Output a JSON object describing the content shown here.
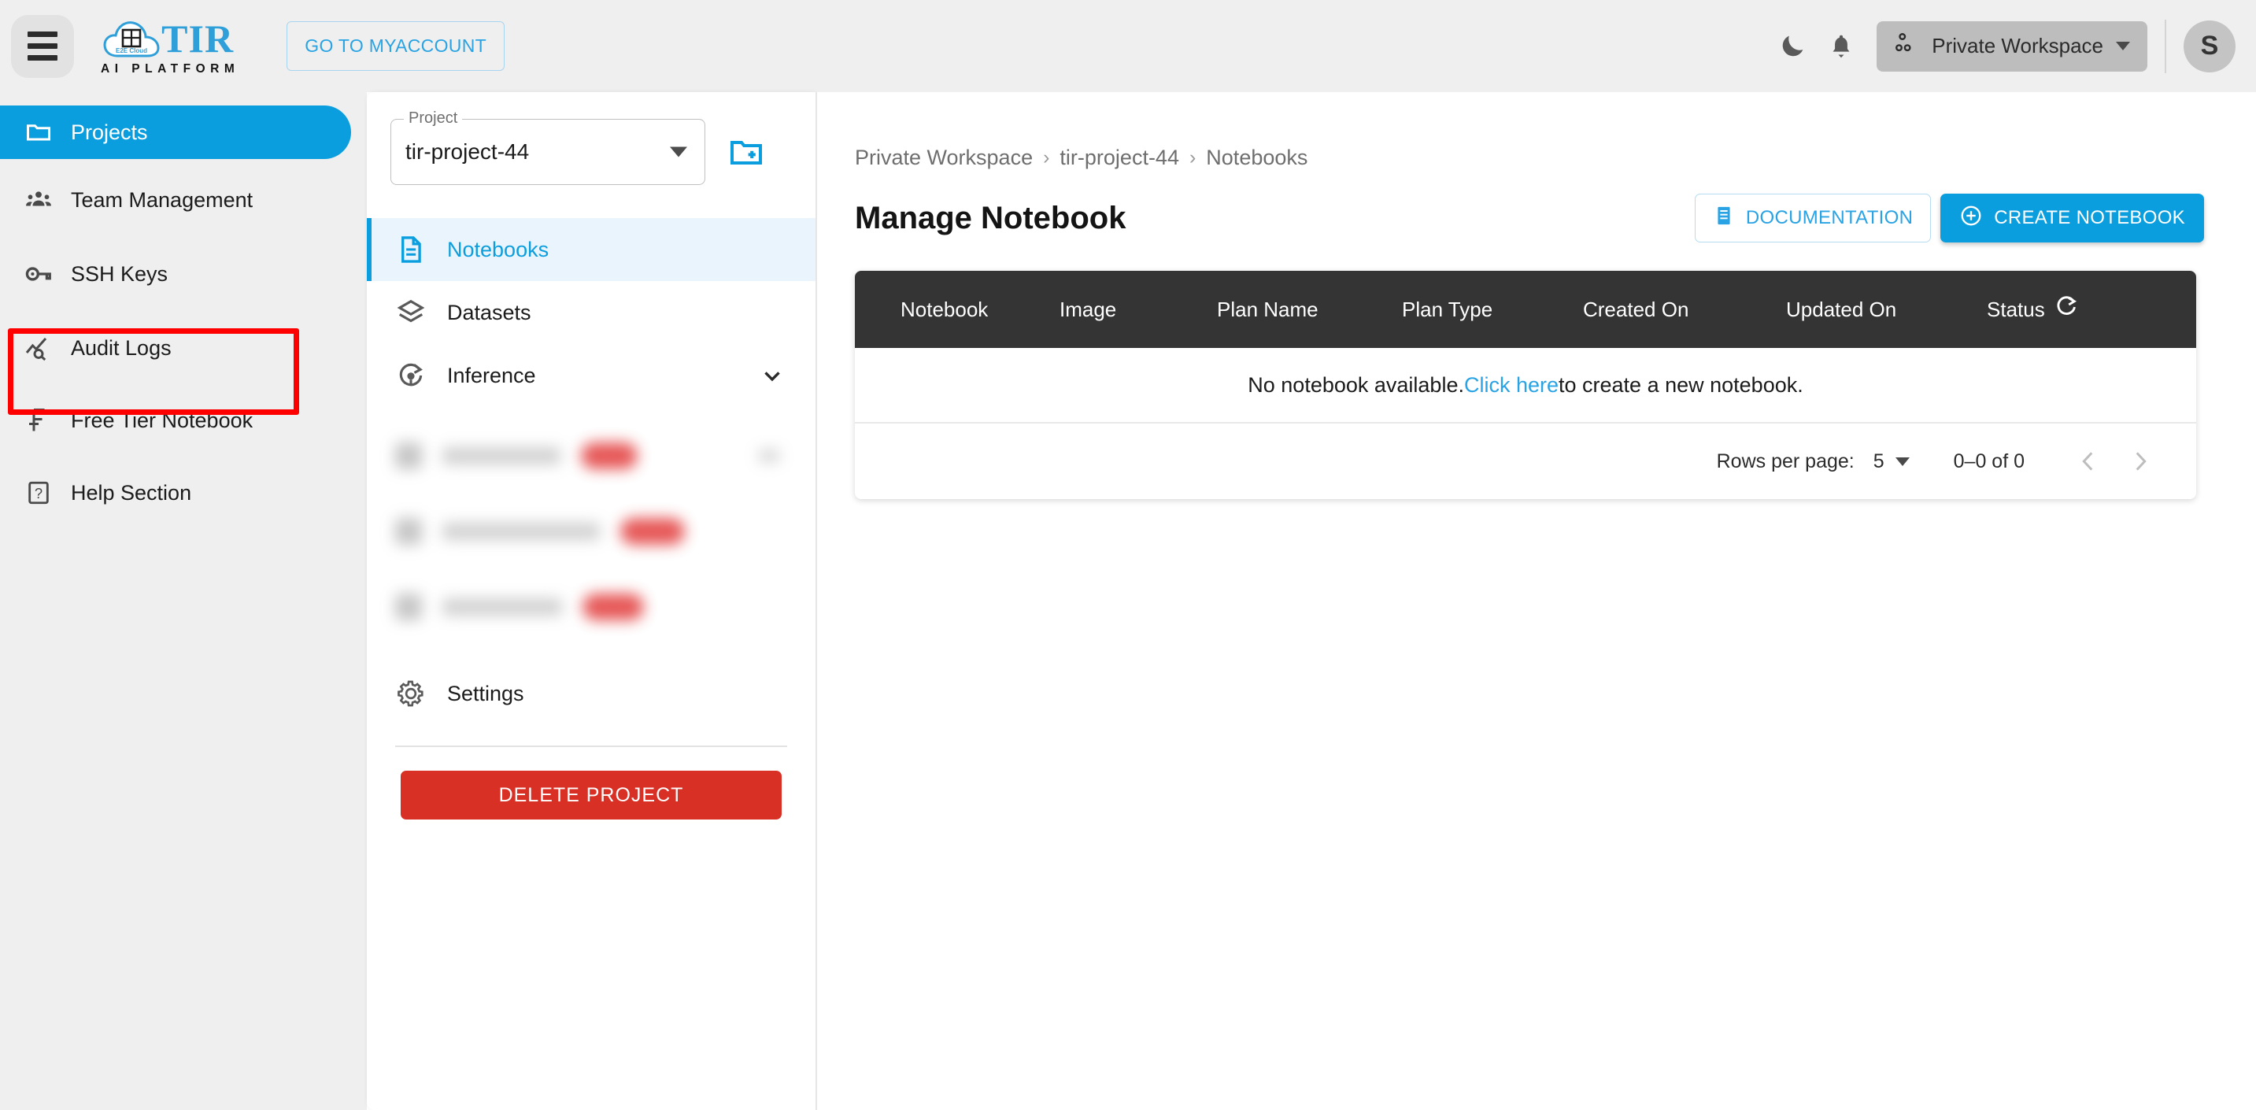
{
  "header": {
    "menu_icon": "hamburger-menu-icon",
    "logo": {
      "brand": "TIR",
      "tagline": "AI PLATFORM",
      "cloud_text": "E2E Cloud"
    },
    "myaccount_label": "GO TO MYACCOUNT",
    "dark_mode_icon": "moon-icon",
    "notifications_icon": "bell-icon",
    "workspace_label": "Private Workspace",
    "workspace_icon": "workspace-group-icon",
    "avatar_initial": "S"
  },
  "sidebar": {
    "items": [
      {
        "label": "Projects",
        "icon": "folder-icon",
        "active": true
      },
      {
        "label": "Team Management",
        "icon": "people-group-icon",
        "active": false
      },
      {
        "label": "SSH Keys",
        "icon": "key-icon",
        "active": false,
        "highlighted": true
      },
      {
        "label": "Audit Logs",
        "icon": "chart-search-icon",
        "active": false
      },
      {
        "label": "Free Tier Notebook",
        "icon": "free-tier-icon",
        "active": false
      },
      {
        "label": "Help Section",
        "icon": "question-box-icon",
        "active": false
      }
    ],
    "highlight_color": "#ff0000"
  },
  "project_panel": {
    "select_legend": "Project",
    "select_value": "tir-project-44",
    "new_project_icon": "new-folder-icon",
    "items": [
      {
        "label": "Notebooks",
        "icon": "notebook-document-icon",
        "active": true,
        "expandable": false
      },
      {
        "label": "Datasets",
        "icon": "layers-icon",
        "active": false,
        "expandable": false
      },
      {
        "label": "Inference",
        "icon": "inference-icon",
        "active": false,
        "expandable": true
      }
    ],
    "redacted_items": [
      {
        "label_width": 150,
        "badge_width": 72,
        "has_chevron": true
      },
      {
        "label_width": 200,
        "badge_width": 82,
        "has_chevron": false
      },
      {
        "label_width": 152,
        "badge_width": 78,
        "has_chevron": false
      }
    ],
    "settings_label": "Settings",
    "settings_icon": "gear-icon",
    "delete_label": "DELETE PROJECT",
    "delete_color": "#d93025"
  },
  "main": {
    "breadcrumb": [
      "Private Workspace",
      "tir-project-44",
      "Notebooks"
    ],
    "breadcrumb_separator": "›",
    "page_title": "Manage Notebook",
    "documentation_label": "DOCUMENTATION",
    "documentation_icon": "document-list-icon",
    "create_label": "CREATE NOTEBOOK",
    "create_icon": "plus-circle-icon",
    "accent_color": "#0b9ede",
    "table": {
      "columns": [
        "Notebook",
        "Image",
        "Plan Name",
        "Plan Type",
        "Created On",
        "Updated On",
        "Status"
      ],
      "status_refresh_icon": "refresh-icon",
      "rows": [],
      "empty_message_before": "No notebook available. ",
      "empty_message_link": "Click here",
      "empty_message_after": " to create a new notebook.",
      "header_bg": "#343434"
    },
    "pagination": {
      "rows_per_page_label": "Rows per page:",
      "rows_per_page_value": "5",
      "range_text": "0–0 of 0",
      "prev_icon": "chevron-left-icon",
      "next_icon": "chevron-right-icon"
    }
  }
}
